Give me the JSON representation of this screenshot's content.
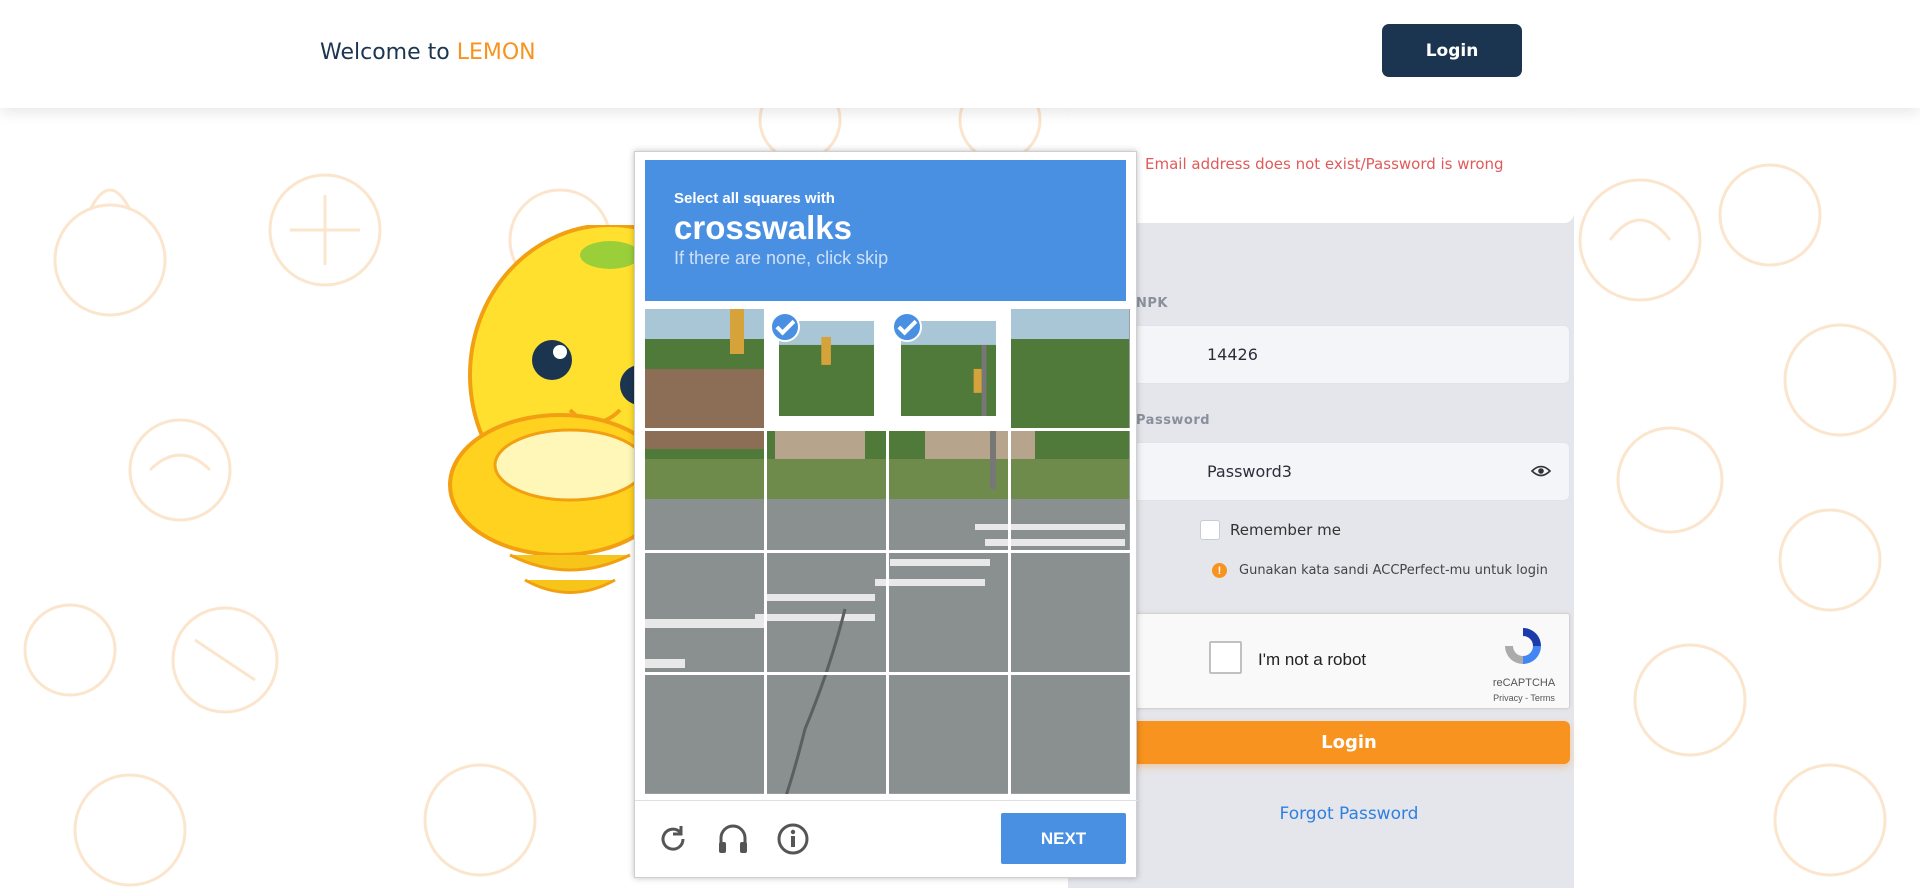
{
  "header": {
    "welcome_prefix": "Welcome to ",
    "brand": "LEMON",
    "login_button": "Login"
  },
  "login_panel": {
    "error_message": "Email address does not exist/Password is wrong",
    "npk_label": "NPK",
    "npk_value": "14426",
    "password_label": "Password",
    "password_value": "Password3",
    "remember_label": "Remember me",
    "hint_icon": "!",
    "hint_text": "Gunakan kata sandi ACCPerfect-mu untuk login",
    "login_button": "Login",
    "forgot_password": "Forgot Password"
  },
  "recaptcha": {
    "label": "I'm not a robot",
    "brand": "reCAPTCHA",
    "terms": "Privacy - Terms"
  },
  "captcha_challenge": {
    "instruction_small": "Select all squares with",
    "target": "crosswalks",
    "instruction_sub": "If there are none, click skip",
    "selected_tiles": [
      1,
      2
    ],
    "next_button": "NEXT",
    "footer_icons": [
      "reload-icon",
      "audio-icon",
      "info-icon"
    ]
  },
  "colors": {
    "navy": "#1b3551",
    "orange": "#f7931e",
    "captcha_blue": "#4a90e2",
    "error_red": "#e05a5a",
    "panel_gray": "#e5e6ec"
  }
}
